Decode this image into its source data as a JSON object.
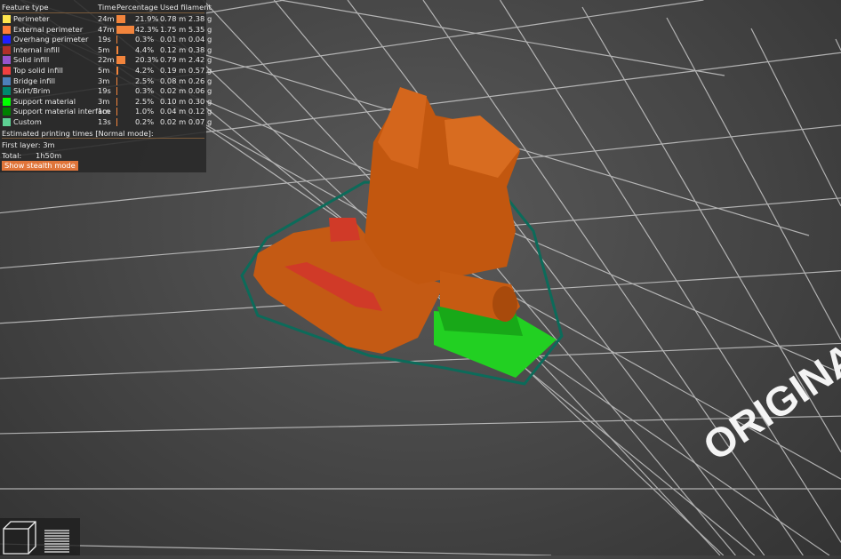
{
  "legend": {
    "headers": {
      "feature": "Feature type",
      "time": "Time",
      "percentage": "Percentage",
      "filament": "Used filament"
    },
    "rows": [
      {
        "label": "Perimeter",
        "time": "24m",
        "percent": "21.9%",
        "filament": "0.78 m 2.38 g",
        "color": "#ffe64d",
        "pct": 21.9
      },
      {
        "label": "External perimeter",
        "time": "47m",
        "percent": "42.3%",
        "filament": "1.75 m 5.35 g",
        "color": "#ff7d38",
        "pct": 42.3
      },
      {
        "label": "Overhang perimeter",
        "time": "19s",
        "percent": "0.3%",
        "filament": "0.01 m 0.04 g",
        "color": "#1f1fff",
        "pct": 0.3
      },
      {
        "label": "Internal infill",
        "time": "5m",
        "percent": "4.4%",
        "filament": "0.12 m 0.38 g",
        "color": "#b03029",
        "pct": 4.4
      },
      {
        "label": "Solid infill",
        "time": "22m",
        "percent": "20.3%",
        "filament": "0.79 m 2.42 g",
        "color": "#9654cc",
        "pct": 20.3
      },
      {
        "label": "Top solid infill",
        "time": "5m",
        "percent": "4.2%",
        "filament": "0.19 m 0.57 g",
        "color": "#f04040",
        "pct": 4.2
      },
      {
        "label": "Bridge infill",
        "time": "3m",
        "percent": "2.5%",
        "filament": "0.08 m 0.26 g",
        "color": "#4d80ba",
        "pct": 2.5
      },
      {
        "label": "Skirt/Brim",
        "time": "19s",
        "percent": "0.3%",
        "filament": "0.02 m 0.06 g",
        "color": "#00876e",
        "pct": 0.3
      },
      {
        "label": "Support material",
        "time": "3m",
        "percent": "2.5%",
        "filament": "0.10 m 0.30 g",
        "color": "#00ff00",
        "pct": 2.5
      },
      {
        "label": "Support material interface",
        "time": "1m",
        "percent": "1.0%",
        "filament": "0.04 m 0.12 g",
        "color": "#008000",
        "pct": 1.0
      },
      {
        "label": "Custom",
        "time": "13s",
        "percent": "0.2%",
        "filament": "0.02 m 0.07 g",
        "color": "#5ed194",
        "pct": 0.2
      }
    ],
    "estimated_title": "Estimated printing times [Normal mode]:",
    "first_layer": "First layer: 3m",
    "total_label": "Total:",
    "total_value": "1h50m",
    "stealth_button": "Show stealth mode"
  },
  "bed_text": "ORIGINAL",
  "view_icons": [
    "3d-view-icon",
    "layers-view-icon"
  ]
}
